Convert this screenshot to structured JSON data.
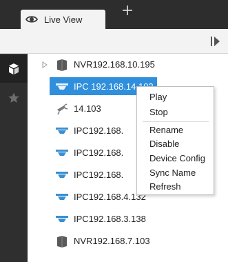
{
  "tabs": [
    {
      "label": "Live View",
      "icon": "eye-icon"
    }
  ],
  "add_tab_icon": "plus-icon",
  "toolbar": {
    "collapse_icon": "collapse-panel-icon"
  },
  "rail": {
    "items": [
      {
        "icon": "device-cube-icon",
        "active": true
      },
      {
        "icon": "star-icon",
        "active": false
      }
    ]
  },
  "tree": {
    "nodes": [
      {
        "label": "NVR192.168.10.195",
        "icon": "nvr-icon",
        "expander": true
      },
      {
        "label": "IPC 192.168.14.102",
        "icon": "dome-camera-icon",
        "selected": true
      },
      {
        "label": "14.103",
        "icon": "offline-camera-icon"
      },
      {
        "label": "IPC192.168.",
        "icon": "dome-camera-icon"
      },
      {
        "label": "IPC192.168.",
        "icon": "dome-camera-icon"
      },
      {
        "label": "IPC192.168.",
        "icon": "dome-camera-icon"
      },
      {
        "label": "IPC192.168.4.132",
        "icon": "dome-camera-icon"
      },
      {
        "label": "IPC192.168.3.138",
        "icon": "dome-camera-icon"
      },
      {
        "label": "NVR192.168.7.103",
        "icon": "nvr-icon"
      }
    ]
  },
  "context_menu": {
    "items": [
      "Play",
      "Stop",
      "Rename",
      "Disable",
      "Device Config",
      "Sync Name",
      "Refresh"
    ]
  },
  "colors": {
    "selection": "#2f8fdc",
    "tab_bar": "#2d2d2d",
    "rail": "#2f2f2f",
    "camera_icon": "#3a8fd0",
    "nvr_icon": "#5a5a5a"
  }
}
